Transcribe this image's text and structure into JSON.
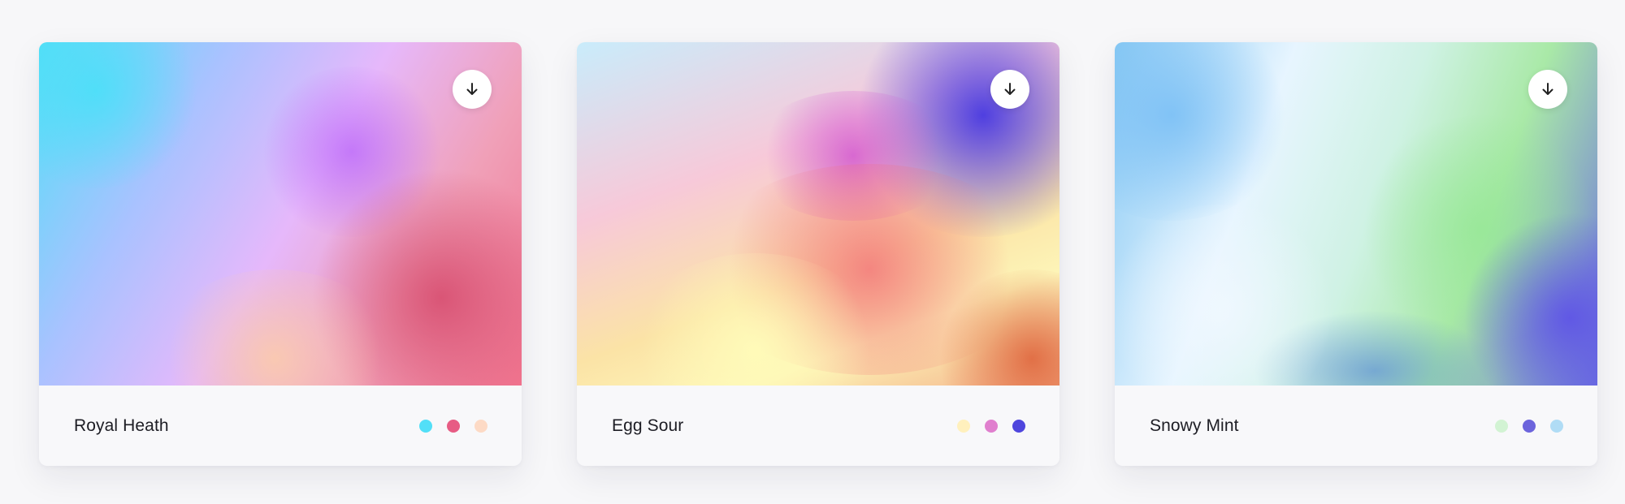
{
  "cards": [
    {
      "name": "Royal Heath",
      "download_icon": "arrow-down-icon",
      "colors": [
        "#52dff7",
        "#e75c84",
        "#fddac5"
      ]
    },
    {
      "name": "Egg Sour",
      "download_icon": "arrow-down-icon",
      "colors": [
        "#fff0bd",
        "#e07fce",
        "#4f46dd"
      ]
    },
    {
      "name": "Snowy Mint",
      "download_icon": "arrow-down-icon",
      "colors": [
        "#d2f3d3",
        "#6c64dc",
        "#b0dcf5"
      ]
    }
  ]
}
